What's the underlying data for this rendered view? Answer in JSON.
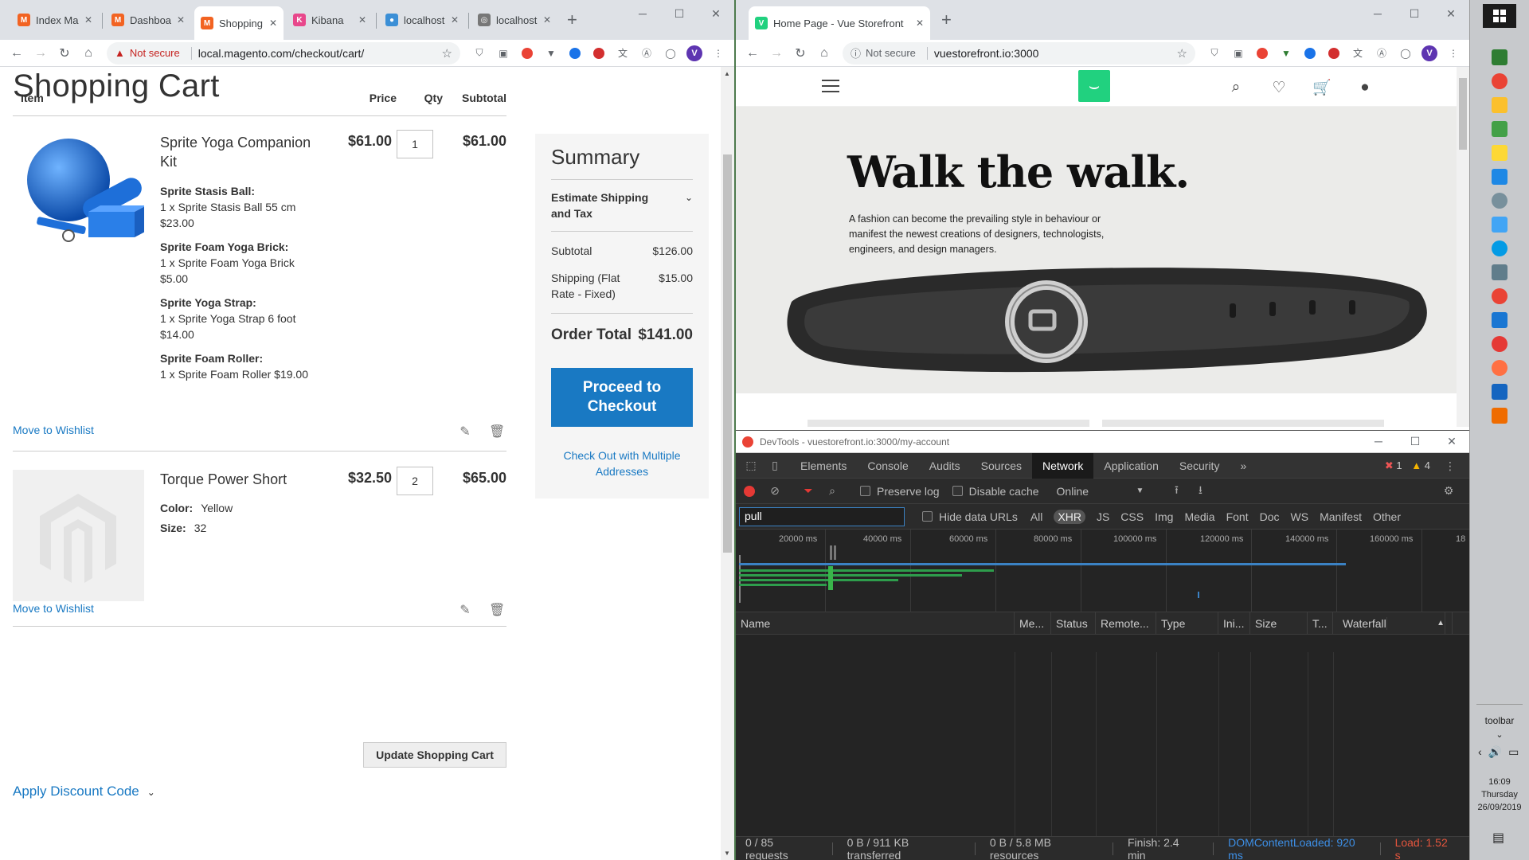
{
  "left_browser": {
    "tabs": [
      {
        "label": "Index Ma",
        "active": false
      },
      {
        "label": "Dashboa",
        "active": false
      },
      {
        "label": "Shopping",
        "active": true
      },
      {
        "label": "Kibana",
        "active": false
      },
      {
        "label": "localhost",
        "active": false
      },
      {
        "label": "localhost",
        "active": false
      }
    ],
    "security": "Not secure",
    "url": "local.magento.com/checkout/cart/"
  },
  "cart": {
    "title": "Shopping Cart",
    "headers": {
      "item": "Item",
      "price": "Price",
      "qty": "Qty",
      "subtotal": "Subtotal"
    },
    "items": [
      {
        "name": "Sprite Yoga Companion Kit",
        "price": "$61.00",
        "qty": "1",
        "subtotal": "$61.00",
        "options": [
          {
            "label": "Sprite Stasis Ball:",
            "line1": "1 x Sprite Stasis Ball 55 cm",
            "line2": "$23.00"
          },
          {
            "label": "Sprite Foam Yoga Brick:",
            "line1": "1 x Sprite Foam Yoga Brick",
            "line2": "$5.00"
          },
          {
            "label": "Sprite Yoga Strap:",
            "line1": "1 x Sprite Yoga Strap 6 foot",
            "line2": "$14.00"
          },
          {
            "label": "Sprite Foam Roller:",
            "line1": "1 x Sprite Foam Roller $19.00",
            "line2": ""
          }
        ],
        "wishlist": "Move to Wishlist"
      },
      {
        "name": "Torque Power Short",
        "price": "$32.50",
        "qty": "2",
        "subtotal": "$65.00",
        "attrs": [
          {
            "label": "Color:",
            "value": "Yellow"
          },
          {
            "label": "Size:",
            "value": "32"
          }
        ],
        "wishlist": "Move to Wishlist"
      }
    ],
    "update_button": "Update Shopping Cart",
    "discount": "Apply Discount Code",
    "summary": {
      "title": "Summary",
      "estimate": "Estimate Shipping and Tax",
      "subtotal_label": "Subtotal",
      "subtotal_value": "$126.00",
      "shipping_label": "Shipping (Flat Rate - Fixed)",
      "shipping_value": "$15.00",
      "total_label": "Order Total",
      "total_value": "$141.00",
      "checkout_button": "Proceed to Checkout",
      "multi_link": "Check Out with Multiple Addresses"
    },
    "colors": {
      "link": "#1979c3",
      "button": "#1979c3"
    }
  },
  "right_browser": {
    "tab_label": "Home Page - Vue Storefront",
    "security": "Not secure",
    "url": "vuestorefront.io:3000"
  },
  "storefront": {
    "hero_title": "Walk the walk.",
    "hero_text": "A fashion can become the prevailing style in behaviour or manifest the newest creations of designers, technologists, engineers, and design managers.",
    "icons": [
      "search-icon",
      "heart-icon",
      "cart-icon",
      "account-icon"
    ],
    "accent": "#21d17f"
  },
  "devtools": {
    "title": "DevTools - vuestorefront.io:3000/my-account",
    "tabs": [
      "Elements",
      "Console",
      "Audits",
      "Sources",
      "Network",
      "Application",
      "Security"
    ],
    "active_tab": "Network",
    "more_tabs": "»",
    "errors": "1",
    "warnings": "4",
    "preserve_log": "Preserve log",
    "disable_cache": "Disable cache",
    "throttle": "Online",
    "filter_value": "pull",
    "hide_data_urls": "Hide data URLs",
    "filter_types": [
      "All",
      "XHR",
      "JS",
      "CSS",
      "Img",
      "Media",
      "Font",
      "Doc",
      "WS",
      "Manifest",
      "Other"
    ],
    "active_filter": "XHR",
    "ticks": [
      "20000 ms",
      "40000 ms",
      "60000 ms",
      "80000 ms",
      "100000 ms",
      "120000 ms",
      "140000 ms",
      "160000 ms",
      "18"
    ],
    "columns": [
      "Name",
      "Me...",
      "Status",
      "Remote...",
      "Type",
      "Ini...",
      "Size",
      "T...",
      "Waterfall"
    ],
    "status": {
      "requests": "0 / 85 requests",
      "transferred": "0 B / 911 KB transferred",
      "resources": "0 B / 5.8 MB resources",
      "finish": "Finish: 2.4 min",
      "dcl": "DOMContentLoaded: 920 ms",
      "load": "Load: 1.52 s"
    }
  },
  "taskbar": {
    "label": "toolbar",
    "time": "16:09",
    "day": "Thursday",
    "date": "26/09/2019"
  }
}
